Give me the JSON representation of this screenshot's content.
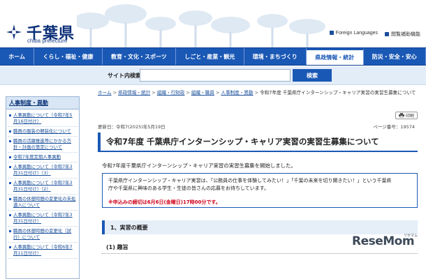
{
  "header": {
    "logo_title": "千葉県",
    "logo_sub": "chiba prefecture",
    "links": [
      {
        "label": "Foreign Languages"
      },
      {
        "label": "閲覧補助機能"
      }
    ]
  },
  "nav": {
    "items": [
      {
        "label": "ホーム"
      },
      {
        "label": "くらし・福祉・健康"
      },
      {
        "label": "教育・文化・スポーツ"
      },
      {
        "label": "しごと・産業・観光"
      },
      {
        "label": "環境・まちづくり"
      },
      {
        "label": "県政情報・統計"
      },
      {
        "label": "防災・安全・安心"
      }
    ],
    "active_index": 5
  },
  "search": {
    "label": "サイト内検索",
    "placeholder": "",
    "button_label": "検索"
  },
  "sidebar": {
    "title": "人事制度・異動",
    "items": [
      {
        "label": "人事異動について（令和7年5月16日付け）"
      },
      {
        "label": "職員の服装の軽装化について"
      },
      {
        "label": "職員の活躍推進等にかかる方針・計画の策定について"
      },
      {
        "label": "令和7年度定期人事異動"
      },
      {
        "label": "人事異動について（令和7年3月31日付け）（3）"
      },
      {
        "label": "人事異動について（令和7年3月31日付け）（2）"
      },
      {
        "label": "職員の休憩時間の変更化の未処遇入について"
      },
      {
        "label": "人事異動について（令和7年3月31日付け）"
      },
      {
        "label": "職員の休憩時間の変更化（試行）について"
      },
      {
        "label": "人事異動について（令和6年7月11日付け）"
      }
    ]
  },
  "breadcrumb": {
    "items": [
      {
        "label": "ホーム"
      },
      {
        "label": "県政情報・統計"
      },
      {
        "label": "組織・行財政"
      },
      {
        "label": "組織・職員"
      },
      {
        "label": "人事制度・異動"
      }
    ],
    "current": "令和7年度 千葉県庁インターンシップ・キャリア実習の実習生募集について"
  },
  "print_label": "印刷",
  "meta": {
    "updated": "更新日：令和7(2025)年5月19日",
    "page_no": "ページ番号：19574"
  },
  "page_title": "令和7年度 千葉県庁インターンシップ・キャリア実習の実習生募集について",
  "intro": "令和7年度千葉県庁インターンシップ・キャリア実習の実習生募集を開始しました。",
  "notice": {
    "line1": "千葉県庁インターンシップ・キャリア実習は、「公務員の仕事を体験してみたい！」「千葉の未来を切り開きたい！」という千葉県",
    "line2": "庁や千葉県に興味のある学生・生徒の皆さんの応募をお待ちしています。",
    "deadline": "※申込みの締切は6月6日(金曜日)17時00分です。"
  },
  "section": {
    "heading": "1、実習の概要",
    "sub": "(1) 趣旨"
  },
  "watermark": {
    "brand": "ReseMom",
    "sub": "リセマム"
  },
  "colors": {
    "nav": "#1a58b5",
    "accent": "#1a58b5",
    "deadline": "#d0021b"
  }
}
